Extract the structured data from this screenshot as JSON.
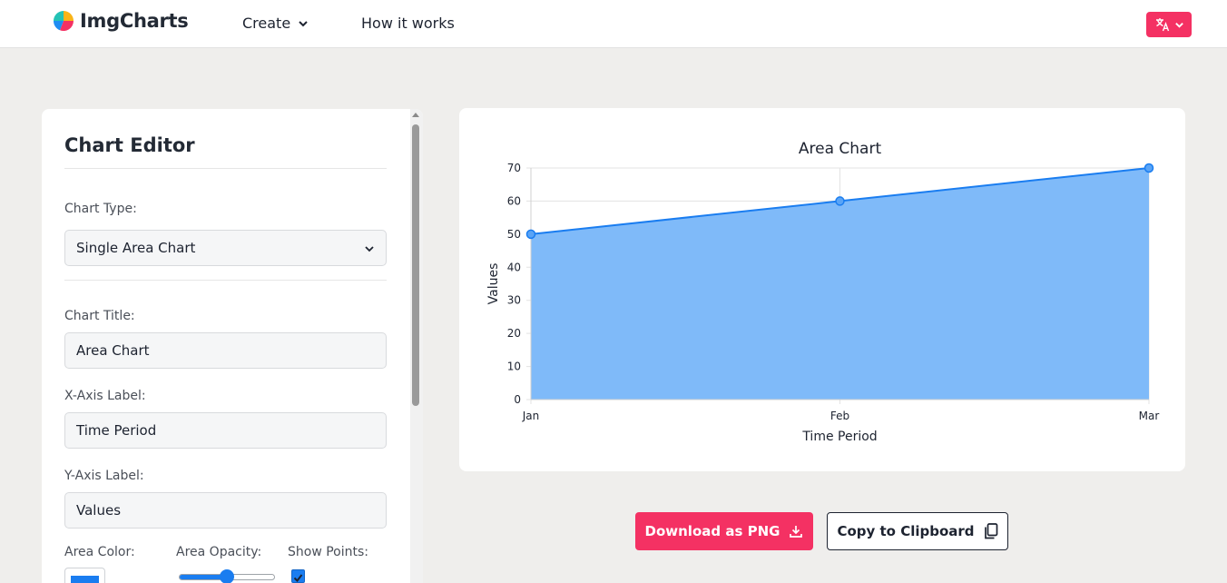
{
  "header": {
    "brand": "ImgCharts",
    "nav": {
      "create": "Create",
      "how_it_works": "How it works"
    },
    "accent_color": "#f43163"
  },
  "editor": {
    "title": "Chart Editor",
    "chart_type_label": "Chart Type:",
    "chart_type_value": "Single Area Chart",
    "chart_title_label": "Chart Title:",
    "chart_title_value": "Area Chart",
    "x_axis_label": "X-Axis Label:",
    "x_axis_value": "Time Period",
    "y_axis_label": "Y-Axis Label:",
    "y_axis_value": "Values",
    "area_color_label": "Area Color:",
    "area_color": "#1a7df0",
    "area_opacity_label": "Area Opacity:",
    "area_opacity": 0.5,
    "show_points_label": "Show Points:",
    "show_points": true
  },
  "chart_data": {
    "type": "area",
    "title": "Area Chart",
    "xlabel": "Time Period",
    "ylabel": "Values",
    "categories": [
      "Jan",
      "Feb",
      "Mar"
    ],
    "values": [
      50,
      60,
      70
    ],
    "ylim": [
      0,
      70
    ],
    "yticks": [
      0,
      10,
      20,
      30,
      40,
      50,
      60,
      70
    ],
    "grid": true,
    "line_color": "#1a7df0",
    "fill_color": "#7fbaf9",
    "show_points": true
  },
  "actions": {
    "download_label": "Download as PNG",
    "copy_label": "Copy to Clipboard"
  }
}
